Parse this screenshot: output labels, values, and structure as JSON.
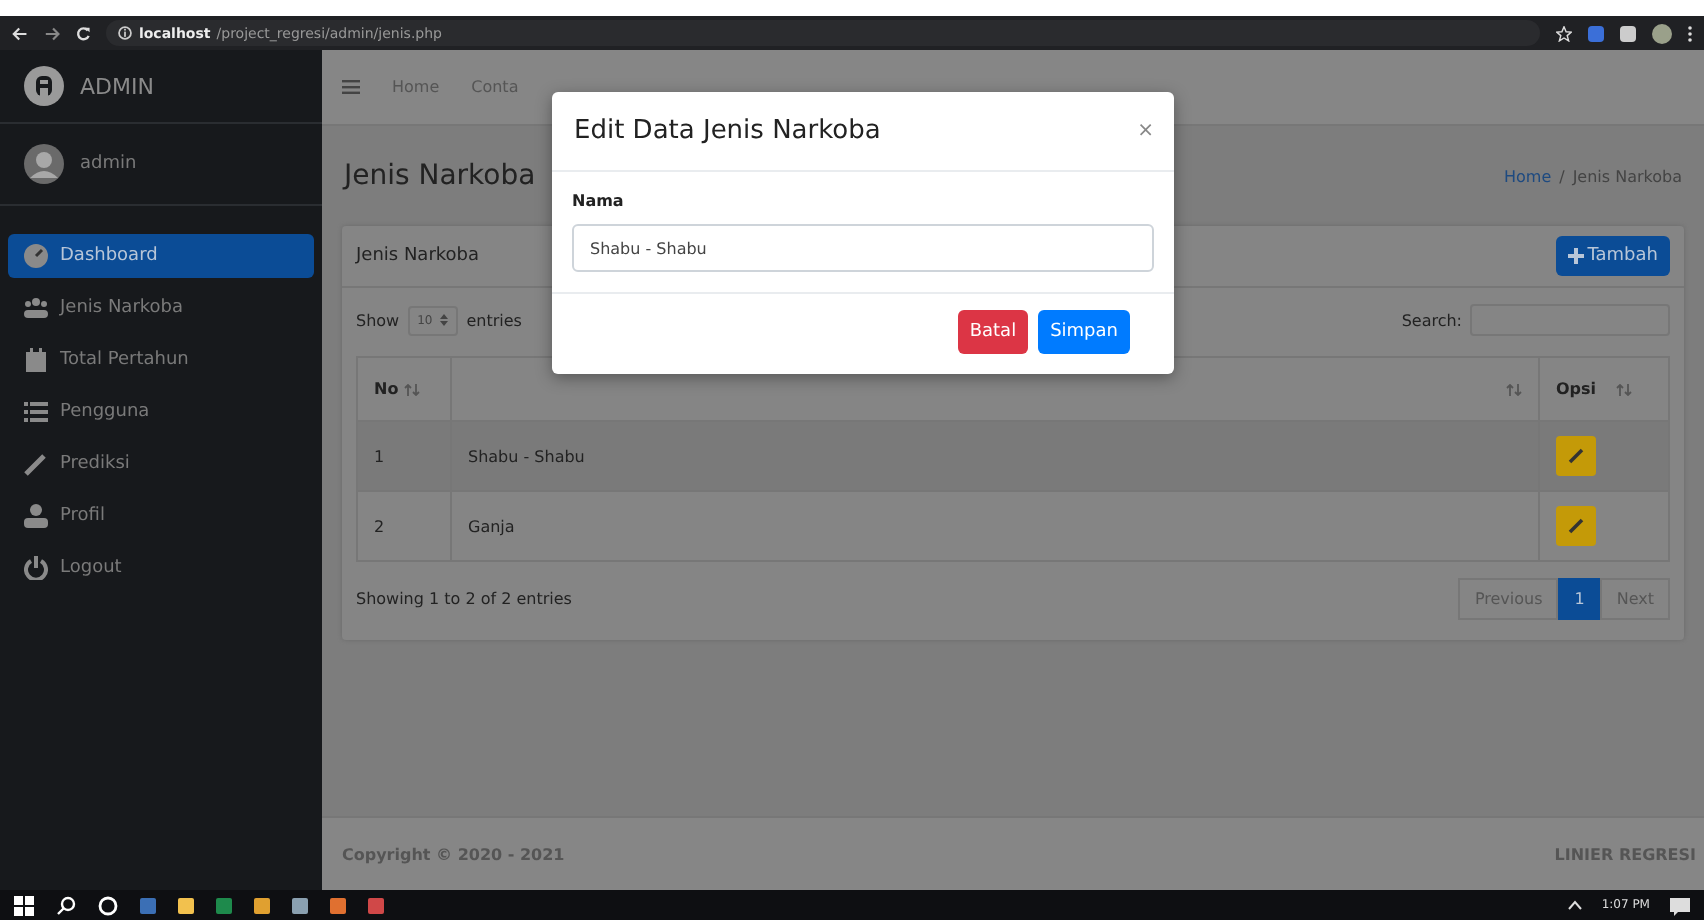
{
  "browser": {
    "url_host": "localhost",
    "url_path": "/project_regresi/admin/jenis.php"
  },
  "sidebar": {
    "brand": "ADMIN",
    "user": "admin",
    "items": [
      {
        "label": "Dashboard",
        "selected": true
      },
      {
        "label": "Jenis Narkoba",
        "selected": false
      },
      {
        "label": "Total Pertahun",
        "selected": false
      },
      {
        "label": "Pengguna",
        "selected": false
      },
      {
        "label": "Prediksi",
        "selected": false
      },
      {
        "label": "Profil",
        "selected": false
      },
      {
        "label": "Logout",
        "selected": false
      }
    ]
  },
  "navbar": {
    "links": [
      "Home",
      "Conta"
    ]
  },
  "page_title": "Jenis Narkoba",
  "breadcrumb": {
    "home": "Home",
    "separator": "/",
    "current": "Jenis Narkoba"
  },
  "card": {
    "title": "Jenis Narkoba",
    "add_button": "Tambah",
    "show_label": "Show",
    "page_size": "10",
    "entries_label": "entries",
    "search_label": "Search:"
  },
  "table": {
    "columns": [
      {
        "label": "No",
        "kind": "sort"
      },
      {
        "kind": "hidden"
      },
      {
        "label": "Opsi",
        "kind": "sort"
      }
    ],
    "rows": [
      {
        "no": "1",
        "name": "Shabu - Shabu"
      },
      {
        "no": "2",
        "name": "Ganja"
      }
    ]
  },
  "info": "Showing 1 to 2 of 2 entries",
  "pagination": [
    {
      "label": "Previous",
      "selected": false
    },
    {
      "label": "1",
      "selected": true
    },
    {
      "label": "Next",
      "selected": false
    }
  ],
  "footer": {
    "copyright": "Copyright © 2020 - 2021",
    "brand": "LINIER REGRESI"
  },
  "modal": {
    "title": "Edit Data Jenis Narkoba",
    "close": "×",
    "field_label": "Nama",
    "value": "Shabu - Shabu",
    "buttons": [
      {
        "label": "Batal",
        "kind": "danger"
      },
      {
        "label": "Simpan",
        "kind": "primary"
      }
    ]
  },
  "taskbar": {
    "time": "1:07 PM"
  }
}
